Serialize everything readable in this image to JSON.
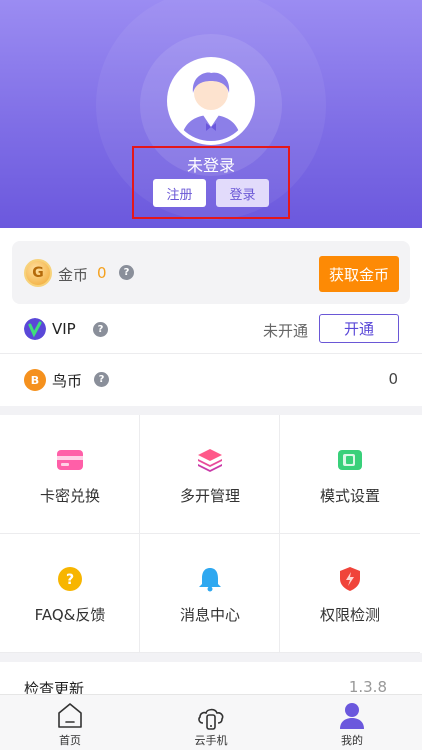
{
  "profile": {
    "status_title": "未登录",
    "register_label": "注册",
    "login_label": "登录"
  },
  "coin": {
    "badge": "G",
    "label": "金币",
    "value": "0",
    "action_label": "获取金币"
  },
  "vip": {
    "label": "VIP",
    "status": "未开通",
    "action_label": "开通"
  },
  "bird": {
    "badge": "B",
    "label": "鸟币",
    "value": "0"
  },
  "grid": [
    {
      "label": "卡密兑换",
      "icon": "card-icon"
    },
    {
      "label": "多开管理",
      "icon": "layers-icon"
    },
    {
      "label": "模式设置",
      "icon": "mode-icon"
    },
    {
      "label": "FAQ&反馈",
      "icon": "question-icon"
    },
    {
      "label": "消息中心",
      "icon": "bell-icon"
    },
    {
      "label": "权限检测",
      "icon": "shield-icon"
    }
  ],
  "update": {
    "label": "检查更新",
    "version": "1.3.8"
  },
  "tabs": [
    {
      "label": "首页",
      "icon": "home-icon"
    },
    {
      "label": "云手机",
      "icon": "cloud-phone-icon"
    },
    {
      "label": "我的",
      "icon": "user-icon"
    }
  ],
  "colors": {
    "brand": "#7f6ee6",
    "accent_orange": "#fd8a05",
    "highlight_box": "#e4171b"
  }
}
